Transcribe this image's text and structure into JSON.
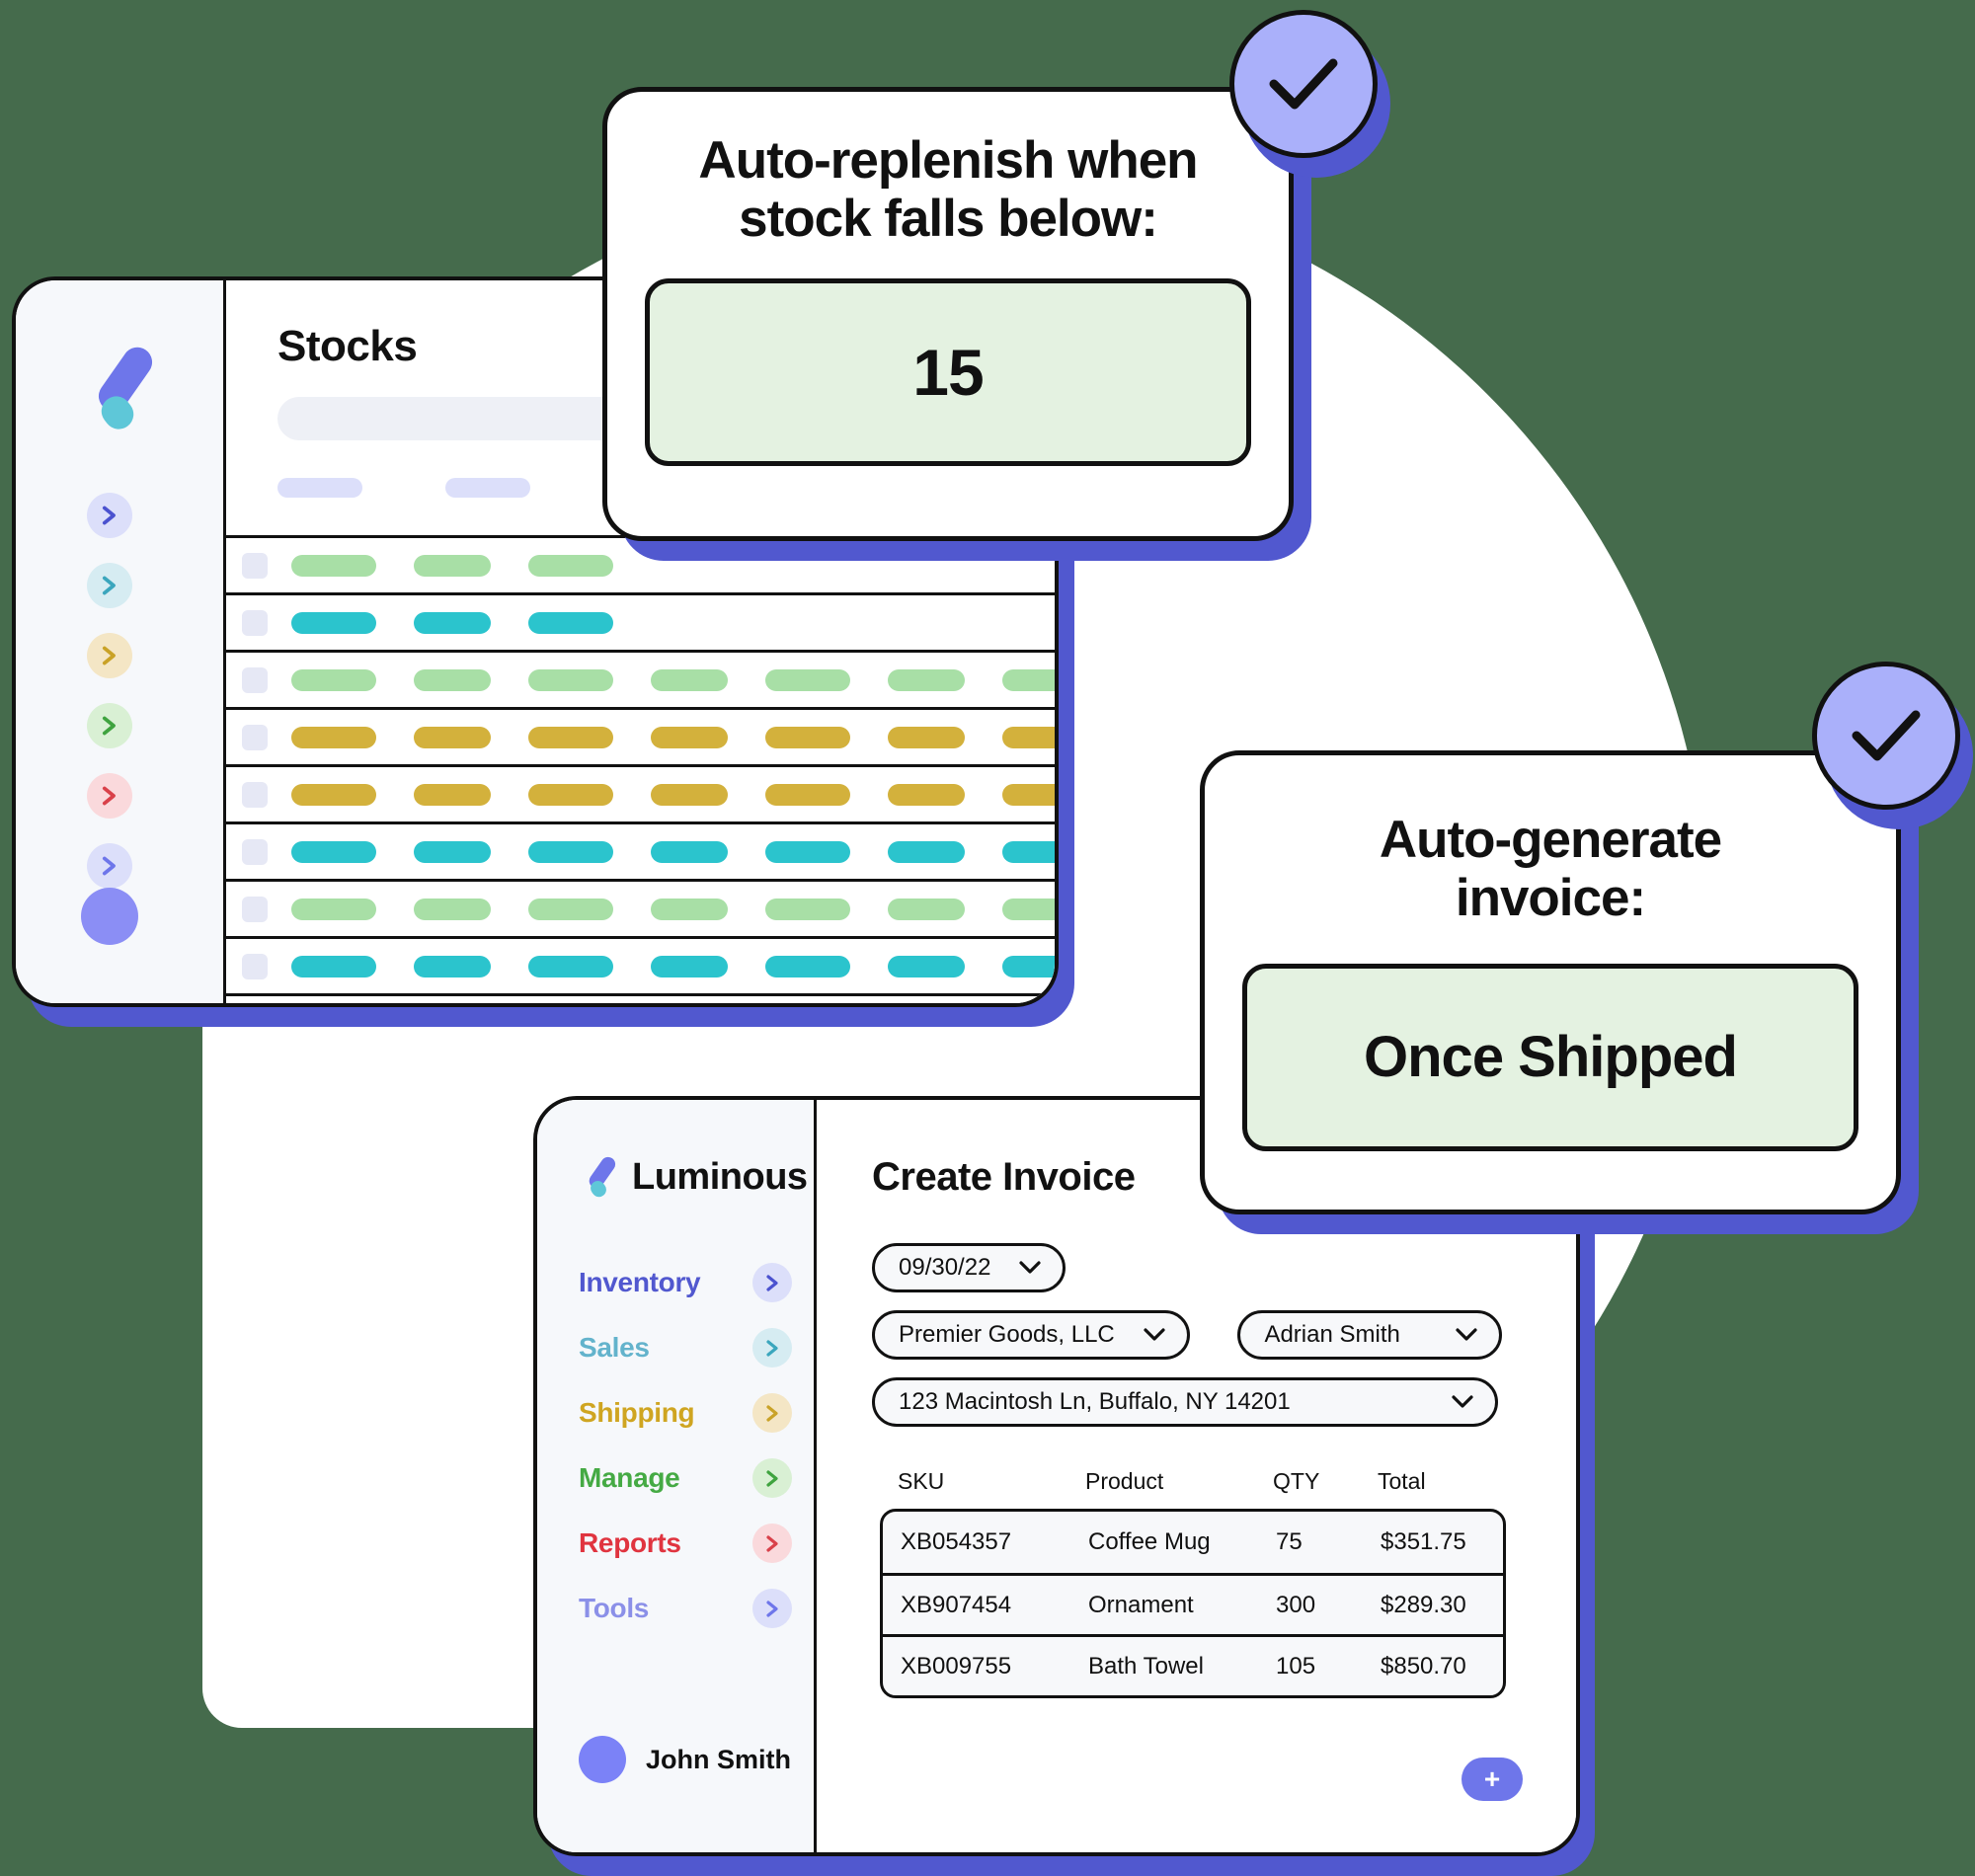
{
  "brand": {
    "name": "Luminous",
    "logo_icon": "luminous-logo-icon",
    "accent": "#6e76ea",
    "accent_dark": "#5158cf",
    "accent_light": "#aab0fa",
    "teal": "#5ec7d8"
  },
  "stocks_window": {
    "title": "Stocks",
    "search_placeholder": "",
    "rail": {
      "logo_icon": "luminous-logo-icon",
      "items": [
        {
          "icon": "chevron-right-icon",
          "chip_bg": "#dcdffa",
          "arrow": "#4b52cf"
        },
        {
          "icon": "chevron-right-icon",
          "chip_bg": "#d6ecf2",
          "arrow": "#3ba6bd"
        },
        {
          "icon": "chevron-right-icon",
          "chip_bg": "#f4e6c5",
          "arrow": "#c9a227"
        },
        {
          "icon": "chevron-right-icon",
          "chip_bg": "#d9f0d4",
          "arrow": "#3fa33f"
        },
        {
          "icon": "chevron-right-icon",
          "chip_bg": "#fad9dc",
          "arrow": "#d9414a"
        },
        {
          "icon": "chevron-right-icon",
          "chip_bg": "#dcdffa",
          "arrow": "#6e76ea"
        }
      ],
      "avatar_icon": "avatar-icon"
    },
    "column_header_count": 3,
    "rows": [
      {
        "color": "#a8dfa6",
        "cells": 3
      },
      {
        "color": "#2bc4cd",
        "cells": 3
      },
      {
        "color": "#a8dfa6",
        "cells": 7
      },
      {
        "color": "#d3b13c",
        "cells": 7
      },
      {
        "color": "#d3b13c",
        "cells": 7
      },
      {
        "color": "#2bc4cd",
        "cells": 7
      },
      {
        "color": "#a8dfa6",
        "cells": 7
      },
      {
        "color": "#2bc4cd",
        "cells": 7
      },
      {
        "color": "#d3b13c",
        "cells": 7
      },
      {
        "color": "#a8dfa6",
        "cells": 7
      }
    ]
  },
  "callouts": [
    {
      "id": "auto-replenish",
      "heading_line1": "Auto-replenish when",
      "heading_line2": "stock falls below:",
      "value": "15",
      "value_bg": "#e4f2e1",
      "badge_icon": "check-icon"
    },
    {
      "id": "auto-generate-invoice",
      "heading_line1": "Auto-generate",
      "heading_line2": "invoice:",
      "value": "Once Shipped",
      "value_bg": "#e4f2e1",
      "badge_icon": "check-icon"
    }
  ],
  "invoice_window": {
    "sidebar": {
      "brand_name": "Luminous",
      "nav": [
        {
          "label": "Inventory",
          "color": "#5158cf",
          "chip_bg": "#dcdffa",
          "arrow": "#4b52cf",
          "icon": "chevron-right-icon"
        },
        {
          "label": "Sales",
          "color": "#63b3cc",
          "chip_bg": "#d6ecf2",
          "arrow": "#3ba6bd",
          "icon": "chevron-right-icon"
        },
        {
          "label": "Shipping",
          "color": "#cfa521",
          "chip_bg": "#f4e6c5",
          "arrow": "#c9a227",
          "icon": "chevron-right-icon"
        },
        {
          "label": "Manage",
          "color": "#45aa44",
          "chip_bg": "#d9f0d4",
          "arrow": "#3fa33f",
          "icon": "chevron-right-icon"
        },
        {
          "label": "Reports",
          "color": "#e0343f",
          "chip_bg": "#fad9dc",
          "arrow": "#d9414a",
          "icon": "chevron-right-icon"
        },
        {
          "label": "Tools",
          "color": "#8b90e8",
          "chip_bg": "#dcdffa",
          "arrow": "#6e76ea",
          "icon": "chevron-right-icon"
        }
      ],
      "user_name": "John Smith",
      "user_avatar_icon": "avatar-icon"
    },
    "main": {
      "title": "Create Invoice",
      "fields": {
        "date": "09/30/22",
        "vendor": "Premier Goods, LLC",
        "contact": "Adrian Smith",
        "address": "123 Macintosh Ln, Buffalo, NY 14201"
      },
      "table": {
        "headers": [
          "SKU",
          "Product",
          "QTY",
          "Total"
        ],
        "rows": [
          {
            "sku": "XB054357",
            "product": "Coffee Mug",
            "qty": "75",
            "total": "$351.75"
          },
          {
            "sku": "XB907454",
            "product": "Ornament",
            "qty": "300",
            "total": "$289.30"
          },
          {
            "sku": "XB009755",
            "product": "Bath Towel",
            "qty": "105",
            "total": "$850.70"
          }
        ]
      },
      "add_button_label": "+"
    }
  }
}
